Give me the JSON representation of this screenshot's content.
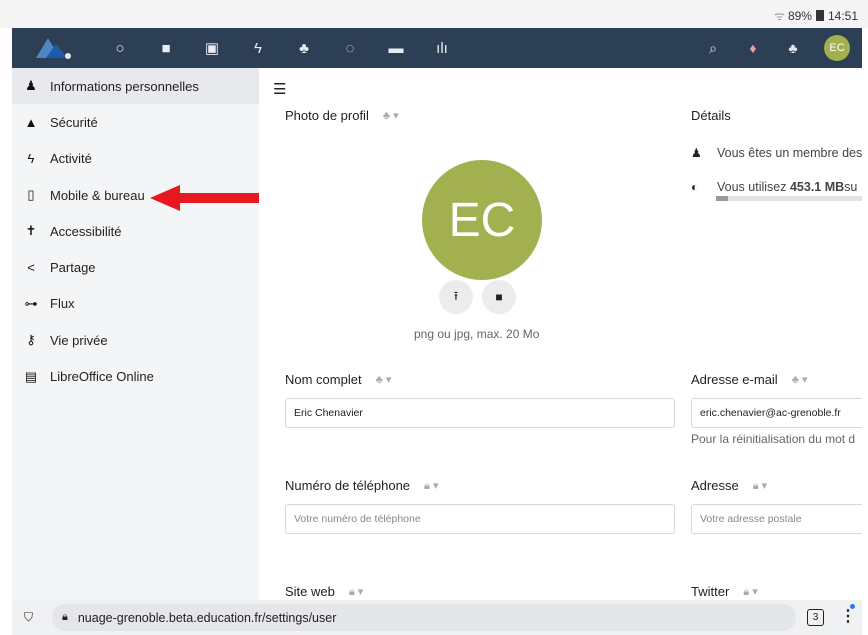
{
  "status_bar": {
    "battery": "89%",
    "time": "14:51"
  },
  "header": {
    "apps": [
      {
        "icon": "circle-icon",
        "glyph": "○"
      },
      {
        "icon": "folder-icon",
        "glyph": "■"
      },
      {
        "icon": "image-icon",
        "glyph": "▣"
      },
      {
        "icon": "activity-icon",
        "glyph": "ϟ"
      },
      {
        "icon": "contacts-icon",
        "glyph": "♣"
      },
      {
        "icon": "circles-icon",
        "glyph": "◌"
      },
      {
        "icon": "deck-icon",
        "glyph": "▬"
      },
      {
        "icon": "stats-icon",
        "glyph": "ılı"
      }
    ],
    "avatar_initials": "EC"
  },
  "sidebar": {
    "items": [
      {
        "label": "Informations personnelles",
        "icon": "user-icon",
        "glyph": "♟"
      },
      {
        "label": "Sécurité",
        "icon": "lock-icon",
        "glyph": "🔒︎"
      },
      {
        "label": "Activité",
        "icon": "activity-icon",
        "glyph": "ϟ"
      },
      {
        "label": "Mobile & bureau",
        "icon": "phone-icon",
        "glyph": "▯"
      },
      {
        "label": "Accessibilité",
        "icon": "accessibility-icon",
        "glyph": "✝"
      },
      {
        "label": "Partage",
        "icon": "share-icon",
        "glyph": "<"
      },
      {
        "label": "Flux",
        "icon": "feed-icon",
        "glyph": "⊶"
      },
      {
        "label": "Vie privée",
        "icon": "key-icon",
        "glyph": "⚷"
      },
      {
        "label": "LibreOffice Online",
        "icon": "document-icon",
        "glyph": "▤"
      }
    ]
  },
  "main": {
    "profile_photo_label": "Photo de profil",
    "avatar_initials": "EC",
    "photo_hint": "png ou jpg, max. 20 Mo",
    "details_label": "Détails",
    "details_member": "Vous êtes un membre des",
    "details_usage_prefix": "Vous utilisez ",
    "details_usage_value": "453.1 MB",
    "details_usage_suffix": " su",
    "quota_fraction": 0.08,
    "fullname_label": "Nom complet",
    "fullname_value": "Eric Chenavier",
    "email_label": "Adresse e-mail",
    "email_value": "eric.chenavier@ac-grenoble.fr",
    "email_note": "Pour la réinitialisation du mot d",
    "phone_label": "Numéro de téléphone",
    "phone_placeholder": "Votre numéro de téléphone",
    "address_label": "Adresse",
    "address_placeholder": "Votre adresse postale",
    "website_label": "Site web",
    "twitter_label": "Twitter"
  },
  "urlbar": {
    "url": "nuage-grenoble.beta.education.fr/settings/user",
    "tabs_count": "3"
  },
  "colors": {
    "header_bg": "#2d3f54",
    "avatar_bg": "#a3b04f",
    "arrow": "#e8181e"
  }
}
